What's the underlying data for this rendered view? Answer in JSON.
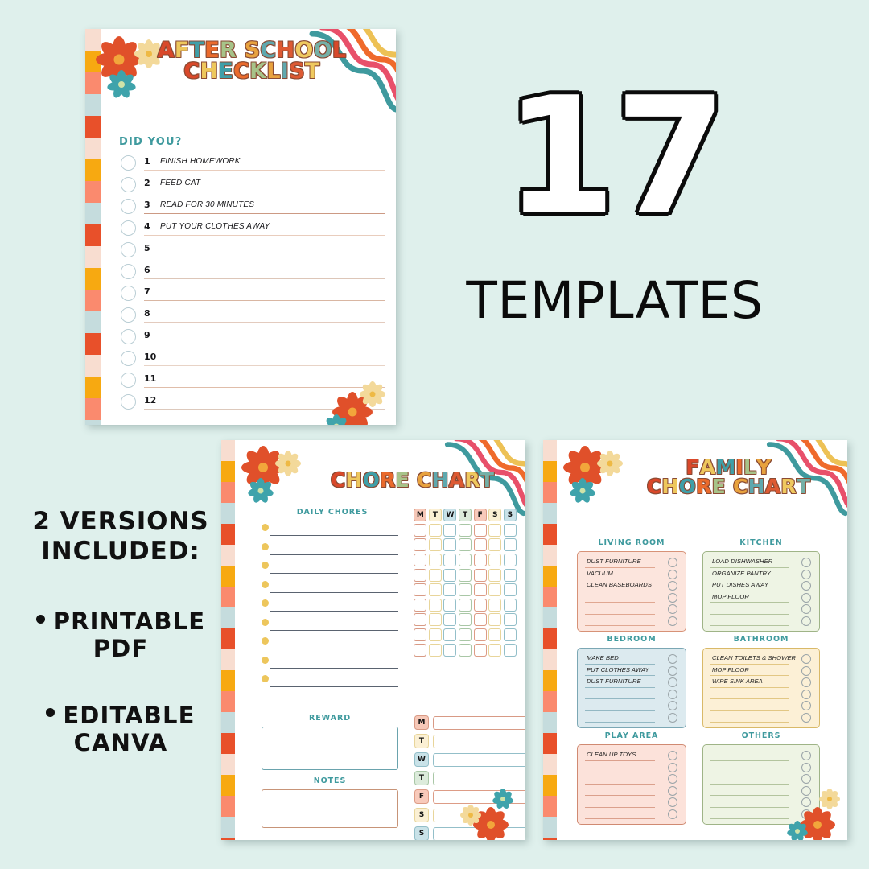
{
  "page": {
    "background_color": "#dff0ec"
  },
  "badge": {
    "number": "17",
    "label": "TEMPLATES",
    "circle_color": "#f4785c",
    "number_color": "#ffffff",
    "outline_color": "#0b0b0b"
  },
  "copy": {
    "heading_line1": "2 VERSIONS",
    "heading_line2": "INCLUDED:",
    "bullets": [
      {
        "line1": "PRINTABLE",
        "line2": "PDF"
      },
      {
        "line1": "EDITABLE",
        "line2": "CANVA"
      }
    ]
  },
  "checklist_card": {
    "title_line1": "AFTER SCHOOL",
    "title_line2": "CHECKLIST",
    "section_heading": "DID YOU?",
    "heading_color": "#3f9a9e",
    "items": [
      {
        "number": "1",
        "text": "FINISH HOMEWORK"
      },
      {
        "number": "2",
        "text": "FEED CAT"
      },
      {
        "number": "3",
        "text": "READ FOR 30 MINUTES"
      },
      {
        "number": "4",
        "text": "PUT YOUR CLOTHES AWAY"
      },
      {
        "number": "5",
        "text": ""
      },
      {
        "number": "6",
        "text": ""
      },
      {
        "number": "7",
        "text": ""
      },
      {
        "number": "8",
        "text": ""
      },
      {
        "number": "9",
        "text": ""
      },
      {
        "number": "10",
        "text": ""
      },
      {
        "number": "11",
        "text": ""
      },
      {
        "number": "12",
        "text": ""
      }
    ]
  },
  "chore_card": {
    "title": "CHORE CHART",
    "daily_heading": "DAILY CHORES",
    "daily_rows": 9,
    "day_headers": [
      "M",
      "T",
      "W",
      "T",
      "F",
      "S",
      "S"
    ],
    "grid_rows": 9,
    "reward_heading": "REWARD",
    "notes_heading": "NOTES",
    "week_rows": [
      "M",
      "T",
      "W",
      "T",
      "F",
      "S",
      "S"
    ]
  },
  "family_card": {
    "title_line1": "FAMILY",
    "title_line2": "CHORE CHART",
    "sections": [
      {
        "heading": "LIVING ROOM",
        "fill": "#fce5dd",
        "border": "#d79277",
        "items": [
          "DUST FURNITURE",
          "VACUUM",
          "CLEAN BASEBOARDS",
          "",
          "",
          ""
        ]
      },
      {
        "heading": "KITCHEN",
        "fill": "#eef4e4",
        "border": "#9fb487",
        "items": [
          "LOAD DISHWASHER",
          "ORGANIZE PANTRY",
          "PUT DISHES AWAY",
          "MOP FLOOR",
          "",
          ""
        ]
      },
      {
        "heading": "BEDROOM",
        "fill": "#dceaef",
        "border": "#7ba7b4",
        "items": [
          "MAKE BED",
          "PUT CLOTHES AWAY",
          "DUST FURNITURE",
          "",
          "",
          ""
        ]
      },
      {
        "heading": "BATHROOM",
        "fill": "#fcf0d6",
        "border": "#d9b968",
        "items": [
          "CLEAN TOILETS & SHOWER",
          "MOP FLOOR",
          "WIPE SINK AREA",
          "",
          "",
          ""
        ]
      },
      {
        "heading": "PLAY AREA",
        "fill": "#fce2da",
        "border": "#d08a72",
        "items": [
          "CLEAN UP TOYS",
          "",
          "",
          "",
          "",
          ""
        ]
      },
      {
        "heading": "OTHERS",
        "fill": "#eef4e4",
        "border": "#9fb487",
        "items": [
          "",
          "",
          "",
          "",
          "",
          ""
        ]
      }
    ]
  },
  "palette": {
    "coral": "#f4785c",
    "teal": "#3f9a9e",
    "mint_bg": "#dff0ec",
    "red_orange": "#e8502a",
    "amber": "#f7a911",
    "salmon": "#fa8a6e",
    "pale_pink": "#f8ddd0",
    "pale_blue": "#c5dcdd",
    "yellow": "#efc95f",
    "green": "#9fc089"
  }
}
